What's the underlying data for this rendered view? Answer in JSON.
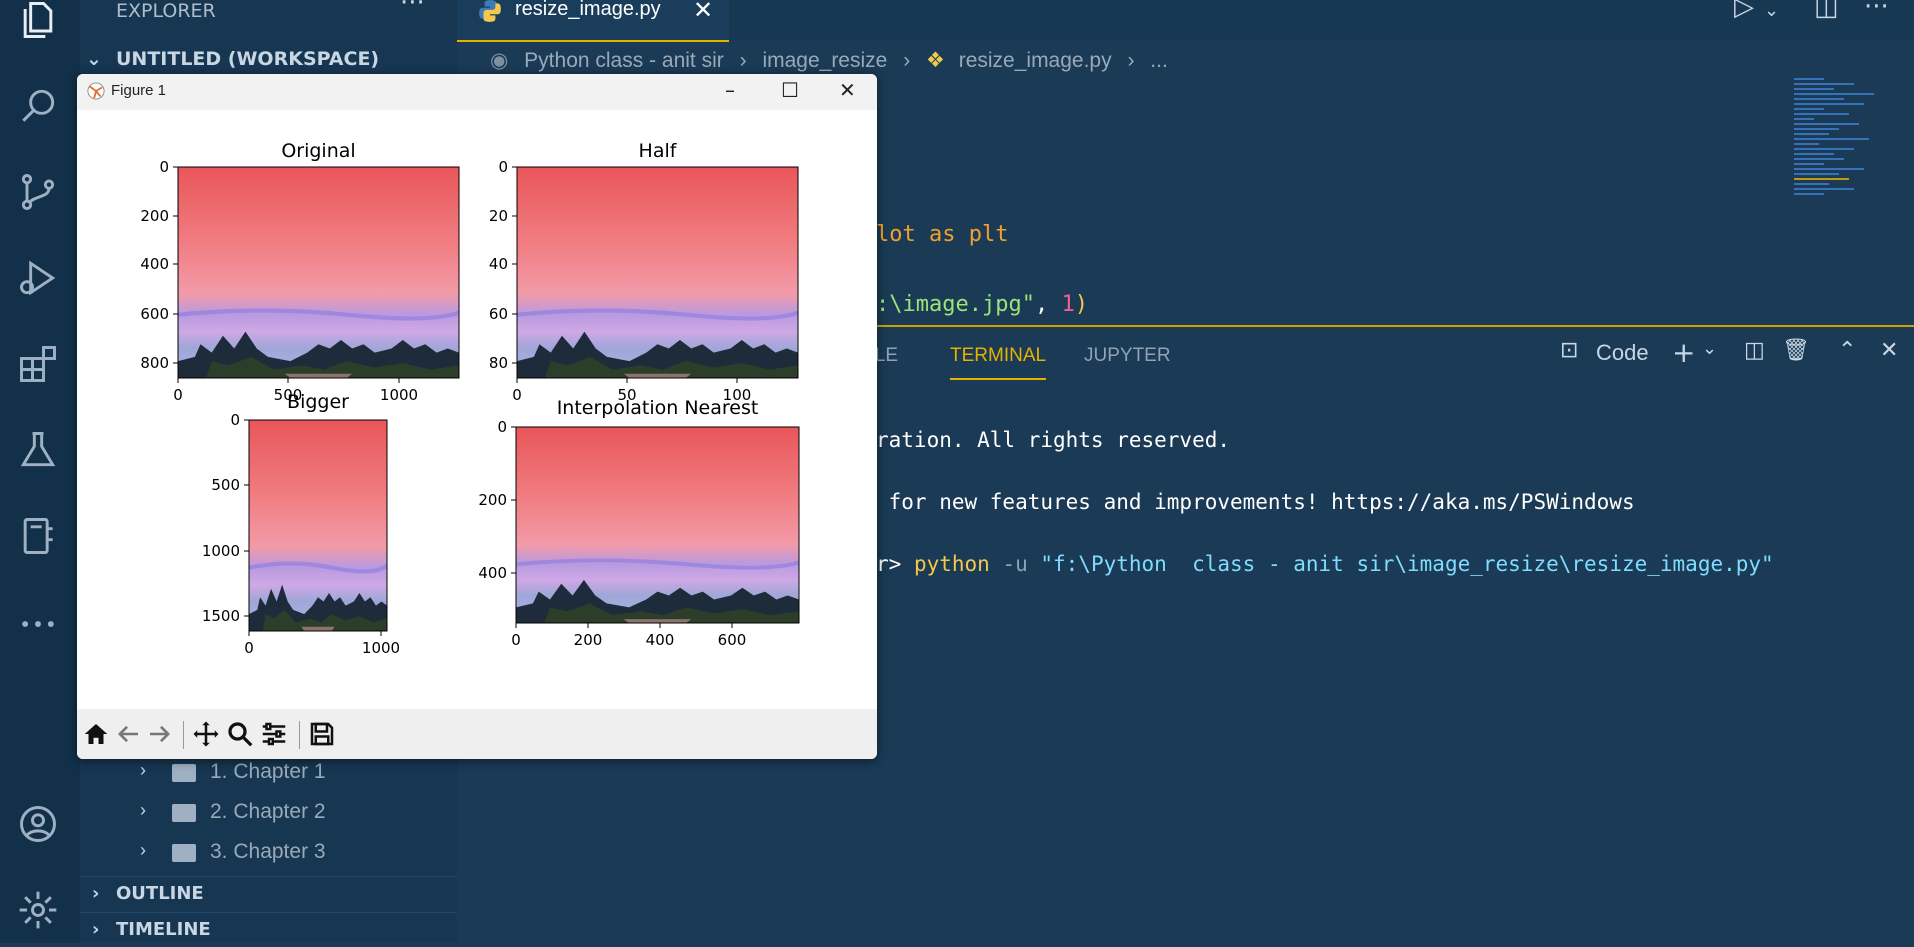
{
  "sidebar": {
    "title": "EXPLORER",
    "more": "···",
    "workspace": "UNTITLED (WORKSPACE)",
    "items": [
      {
        "label": "1. Chapter 1"
      },
      {
        "label": "2. Chapter 2"
      },
      {
        "label": "3. Chapter 3"
      }
    ],
    "sections": [
      "OUTLINE",
      "TIMELINE"
    ]
  },
  "tab": {
    "name": "resize_image.py",
    "close": "✕"
  },
  "breadcrumb": [
    "Python  class - anit sir",
    "image_resize",
    "resize_image.py",
    "..."
  ],
  "code": {
    "line1": "lot as plt",
    "line2_str": ":\\image.jpg\"",
    "line2_comma": ", ",
    "line2_num": "1",
    "line2_paren": ")"
  },
  "panel": {
    "tabs": [
      "OLE",
      "TERMINAL",
      "JUPYTER"
    ],
    "active": "TERMINAL",
    "shell": "Code"
  },
  "terminal": {
    "line1": "ration. All rights reserved.",
    "line2": " for new features and improvements! https://aka.ms/PSWindows",
    "prompt": "r> ",
    "cmd": "python",
    "flag": " -u ",
    "path": "\"f:\\Python  class - anit sir\\image_resize\\resize_image.py\""
  },
  "figure": {
    "window_title": "Figure 1",
    "subplots": [
      {
        "title": "Original",
        "xticks": [
          "0",
          "500",
          "1000"
        ],
        "yticks": [
          "0",
          "200",
          "400",
          "600",
          "800"
        ]
      },
      {
        "title": "Half",
        "xticks": [
          "0",
          "50",
          "100"
        ],
        "yticks": [
          "0",
          "20",
          "40",
          "60",
          "80"
        ]
      },
      {
        "title": "Bigger",
        "xticks": [
          "0",
          "1000"
        ],
        "yticks": [
          "0",
          "500",
          "1000",
          "1500"
        ]
      },
      {
        "title": "Interpolation Nearest",
        "xticks": [
          "0",
          "200",
          "400",
          "600"
        ],
        "yticks": [
          "0",
          "200",
          "400"
        ]
      }
    ]
  },
  "colors": {
    "accent": "#e6b200",
    "editor_bg": "#1a3a55",
    "keyword_orange": "#f0a030",
    "string_green": "#9be37a",
    "number_pink": "#f06090"
  }
}
